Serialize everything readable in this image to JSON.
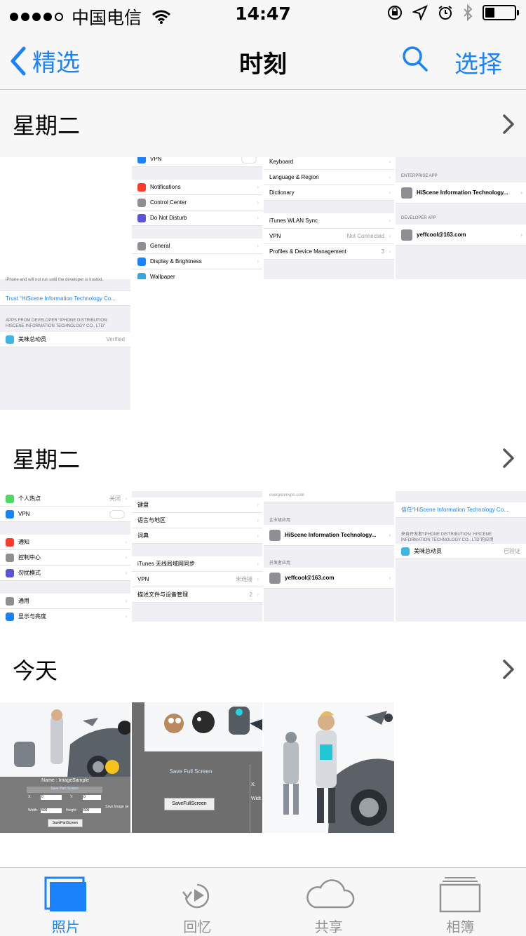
{
  "status_bar": {
    "carrier": "中国电信",
    "time": "14:47",
    "battery_level": 0.3
  },
  "nav": {
    "back_label": "精选",
    "title": "时刻",
    "select_label": "选择"
  },
  "sections": [
    {
      "title": "星期二"
    },
    {
      "title": "星期二"
    },
    {
      "title": "今天"
    }
  ],
  "thumbs_en": {
    "vpn": "VPN",
    "notifications": "Notifications",
    "control_center": "Control Center",
    "dnd": "Do Not Disturb",
    "general": "General",
    "display": "Display & Brightness",
    "wallpaper": "Wallpaper",
    "keyboard": "Keyboard",
    "lang": "Language & Region",
    "dictionary": "Dictionary",
    "itunes": "iTunes WLAN Sync",
    "vpn_status": "Not Connected",
    "profiles": "Profiles & Device Management",
    "profiles_count": "3",
    "enterprise_head": "ENTERPRISE APP",
    "enterprise_app": "HiScene Information Technology...",
    "developer_head": "DEVELOPER APP",
    "developer_app": "yeffcool@163.com",
    "trust_note": "iPhone and will not run until the developer is trusted.",
    "trust_link": "Trust “HiScene Information Technology Co...",
    "apps_from": "APPS FROM DEVELOPER “IPHONE DISTRIBUTION:",
    "apps_from2": "HISCENE INFORMATION TECHNOLOGY CO., LTD”",
    "app_name": "美味总动员",
    "app_status": "Verified"
  },
  "thumbs_cn": {
    "hotspot": "个人热点",
    "hotspot_val": "关闭",
    "vpn": "VPN",
    "notif": "通知",
    "cc": "控制中心",
    "dnd": "勿扰模式",
    "general": "通用",
    "display": "显示与亮度",
    "keyboard": "键盘",
    "lang": "语言与地区",
    "dict": "词典",
    "itunes": "iTunes 无线局域网同步",
    "vpn_status": "未连接",
    "profiles": "描述文件与设备管理",
    "profiles_count": "2",
    "greenvpn": "evergreenvpn.com",
    "enterprise_head": "企业级应用",
    "enterprise_app": "HiScene Information Technology...",
    "developer_head": "开发者应用",
    "developer_app": "yeffcool@163.com",
    "trust_link": "信任“HiScene Information Technology Co....",
    "apps_from": "来自开发者“IPHONE DISTRIBUTION: HISCENE",
    "apps_from2": "INFORMATION TECHNOLOGY CO., LTD”的应用",
    "app_name": "美味总动员",
    "app_status": "已验证"
  },
  "today_thumbs": {
    "name_label": "Name : ImageSample",
    "save_part": "Save Part Screen",
    "save_part_btn": "SavePartScreen",
    "save_full": "Save Full Screen",
    "save_full_btn": "SaveFullScreen",
    "save_image": "Save Image (w",
    "x_label": "X:",
    "y_label": "Y:",
    "width_label": "Width:",
    "height_label": "Height:",
    "x_val": "0",
    "y_val": "0",
    "w_val": "500",
    "h_val": "500",
    "widt": "Widt"
  },
  "tabs": [
    {
      "label": "照片",
      "icon": "photos-icon",
      "active": true
    },
    {
      "label": "回忆",
      "icon": "memories-icon",
      "active": false
    },
    {
      "label": "共享",
      "icon": "cloud-icon",
      "active": false
    },
    {
      "label": "相簿",
      "icon": "albums-icon",
      "active": false
    }
  ],
  "colors": {
    "accent": "#1a82fb",
    "bar_bg": "#f7f7f7",
    "grouped_bg": "#efeff4"
  }
}
